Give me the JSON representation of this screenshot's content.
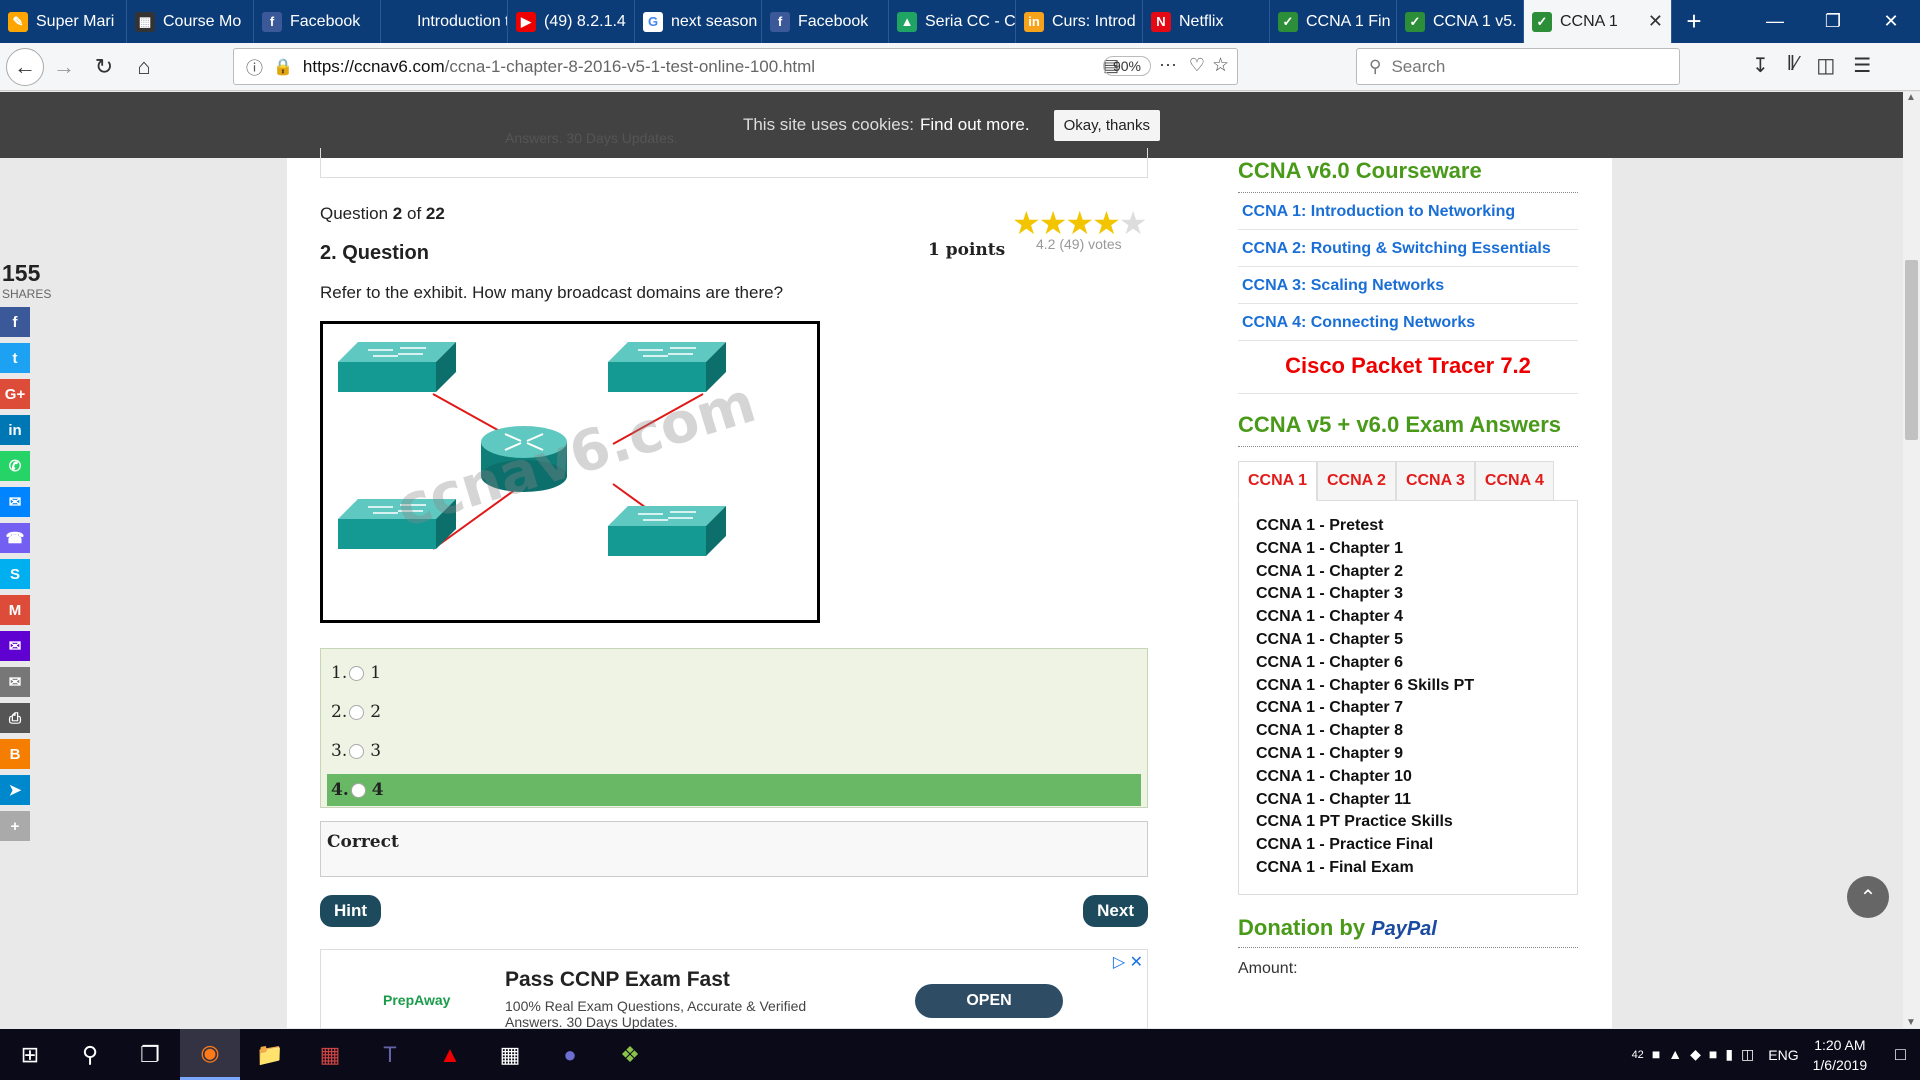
{
  "browser": {
    "tabs": [
      {
        "label": "Super Mari",
        "icon": "orange",
        "glyph": "✎"
      },
      {
        "label": "Course Mo",
        "icon": "#333",
        "glyph": "▦"
      },
      {
        "label": "Facebook",
        "icon": "#3b5998",
        "glyph": "f"
      },
      {
        "label": "Introduction to",
        "icon": "#0c3c78",
        "glyph": ""
      },
      {
        "label": "(49) 8.2.1.4",
        "icon": "#e00",
        "glyph": "▶"
      },
      {
        "label": "next season",
        "icon": "#fff",
        "glyph": "G"
      },
      {
        "label": "Facebook",
        "icon": "#3b5998",
        "glyph": "f"
      },
      {
        "label": "Seria CC - C",
        "icon": "#1fa463",
        "glyph": "▲"
      },
      {
        "label": "Curs: Introd",
        "icon": "#f7a21b",
        "glyph": "in"
      },
      {
        "label": "Netflix",
        "icon": "#e50914",
        "glyph": "N"
      },
      {
        "label": "CCNA 1 Fin",
        "icon": "#2d8e3a",
        "glyph": "✓"
      },
      {
        "label": "CCNA 1 v5.",
        "icon": "#2d8e3a",
        "glyph": "✓"
      }
    ],
    "active_tab": {
      "label": "CCNA 1",
      "icon": "#2d8e3a",
      "glyph": "✓"
    },
    "url_domain": "https://ccnav6.com",
    "url_path": "/ccna-1-chapter-8-2016-v5-1-test-online-100.html",
    "zoom": "90%",
    "search_placeholder": "Search"
  },
  "cookie": {
    "text": "This site uses cookies:",
    "link": "Find out more.",
    "button": "Okay, thanks"
  },
  "share": {
    "count": "155",
    "label": "SHARES",
    "buttons": [
      {
        "name": "facebook",
        "color": "#3b5998",
        "glyph": "f"
      },
      {
        "name": "twitter",
        "color": "#1da1f2",
        "glyph": "t"
      },
      {
        "name": "googleplus",
        "color": "#dd4b39",
        "glyph": "G+"
      },
      {
        "name": "linkedin",
        "color": "#0077b5",
        "glyph": "in"
      },
      {
        "name": "whatsapp",
        "color": "#25d366",
        "glyph": "✆"
      },
      {
        "name": "messenger",
        "color": "#0084ff",
        "glyph": "✉"
      },
      {
        "name": "viber",
        "color": "#7360f2",
        "glyph": "☎"
      },
      {
        "name": "skype",
        "color": "#00aff0",
        "glyph": "S"
      },
      {
        "name": "gmail",
        "color": "#dd4b39",
        "glyph": "M"
      },
      {
        "name": "yahoo",
        "color": "#5f01d1",
        "glyph": "✉"
      },
      {
        "name": "email",
        "color": "#777",
        "glyph": "✉"
      },
      {
        "name": "print",
        "color": "#555",
        "glyph": "⎙"
      },
      {
        "name": "blogger",
        "color": "#f57d00",
        "glyph": "B"
      },
      {
        "name": "telegram",
        "color": "#0088cc",
        "glyph": "➤"
      },
      {
        "name": "more",
        "color": "#aaa",
        "glyph": "+"
      }
    ]
  },
  "question": {
    "counter_prefix": "Question",
    "current": "2",
    "of": "of",
    "total": "22",
    "title": "2. Question",
    "points": "1 points",
    "rating": 4.2,
    "votes": "4.2 (49) votes",
    "text": "Refer to the exhibit. How many broadcast domains are there?",
    "watermark": "ccnav6.com",
    "answers": [
      {
        "num": "1.",
        "label": "1"
      },
      {
        "num": "2.",
        "label": "2"
      },
      {
        "num": "3.",
        "label": "3"
      },
      {
        "num": "4.",
        "label": "4",
        "correct": true
      }
    ],
    "result": "Correct",
    "hint": "Hint",
    "next": "Next"
  },
  "ad": {
    "brand": "PrepAway",
    "title": "Pass CCNP Exam Fast",
    "desc": "100% Real Exam Questions, Accurate & Verified Answers. 30 Days Updates.",
    "button": "OPEN",
    "top_desc": "Answers. 30 Days Updates."
  },
  "sidebar": {
    "courseware_title": "CCNA v6.0 Courseware",
    "links": [
      "CCNA 1: Introduction to Networking",
      "CCNA 2: Routing & Switching Essentials",
      "CCNA 3: Scaling Networks",
      "CCNA 4: Connecting Networks"
    ],
    "packet_tracer": "Cisco Packet Tracer 7.2",
    "exam_title": "CCNA v5 + v6.0 Exam Answers",
    "tabs": [
      "CCNA 1",
      "CCNA 2",
      "CCNA 3",
      "CCNA 4"
    ],
    "list": [
      "CCNA 1 - Pretest",
      "CCNA 1 - Chapter 1",
      "CCNA 1 - Chapter 2",
      "CCNA 1 - Chapter 3",
      "CCNA 1 - Chapter 4",
      "CCNA 1 - Chapter 5",
      "CCNA 1 - Chapter 6",
      "CCNA 1 - Chapter 6 Skills PT",
      "CCNA 1 - Chapter 7",
      "CCNA 1 - Chapter 8",
      "CCNA 1 - Chapter 9",
      "CCNA 1 - Chapter 10",
      "CCNA 1 - Chapter 11",
      "CCNA 1 PT Practice Skills",
      "CCNA 1 - Practice Final",
      "CCNA 1 - Final Exam"
    ],
    "donation": "Donation by",
    "paypal": "PayPal",
    "amount": "Amount:"
  },
  "taskbar": {
    "time": "1:20 AM",
    "date": "1/6/2019",
    "lang": "ENG",
    "notif": "42"
  }
}
